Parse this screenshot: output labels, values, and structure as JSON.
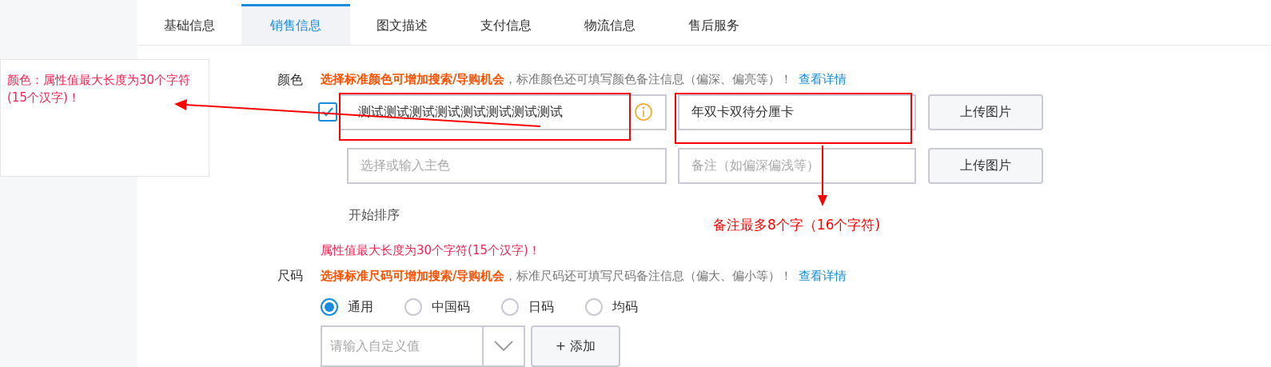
{
  "tabs": [
    {
      "label": "基础信息",
      "selected": false
    },
    {
      "label": "销售信息",
      "selected": true
    },
    {
      "label": "图文描述",
      "selected": false
    },
    {
      "label": "支付信息",
      "selected": false
    },
    {
      "label": "物流信息",
      "selected": false
    },
    {
      "label": "售后服务",
      "selected": false
    }
  ],
  "tooltip": {
    "text": "颜色：属性值最大长度为30个字符(15个汉字)！"
  },
  "color": {
    "label": "颜色",
    "hint_bold": "选择标准颜色可增加搜索/导购机会",
    "hint": "，标准颜色还可填写颜色备注信息（偏深、偏亮等）！",
    "link": "查看详情",
    "rows": [
      {
        "checked": true,
        "value": "测试测试测试测试测试测试测试测试",
        "note_value": "年双卡双待分厘卡",
        "upload": "上传图片"
      },
      {
        "placeholder": "选择或输入主色",
        "note_placeholder": "备注（如偏深偏浅等）",
        "upload": "上传图片"
      }
    ],
    "sort": "开始排序",
    "error": "属性值最大长度为30个字符(15个汉字)！"
  },
  "size": {
    "label": "尺码",
    "hint_bold": "选择标准尺码可增加搜索/导购机会",
    "hint": "，标准尺码还可填写尺码备注信息（偏大、偏小等）！",
    "link": "查看详情",
    "options": [
      {
        "label": "通用",
        "selected": true
      },
      {
        "label": "中国码",
        "selected": false
      },
      {
        "label": "日码",
        "selected": false
      },
      {
        "label": "均码",
        "selected": false
      }
    ],
    "custom_placeholder": "请输入自定义值",
    "add": "+ 添加"
  },
  "annotation": {
    "text": "备注最多8个字（16个字符)"
  }
}
